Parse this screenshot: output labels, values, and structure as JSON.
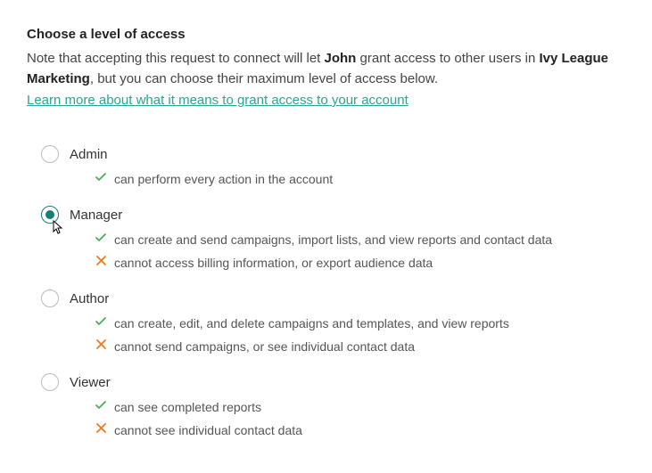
{
  "heading": "Choose a level of access",
  "note": {
    "prefix": "Note that accepting this request to connect will let ",
    "user": "John",
    "middle": " grant access to other users in ",
    "company": "Ivy League Marketing",
    "suffix": ", but you can choose their maximum level of access below."
  },
  "link_text": "Learn more about what it means to grant access to your account",
  "options": {
    "admin": {
      "label": "Admin",
      "can1": "can perform every action in the account"
    },
    "manager": {
      "label": "Manager",
      "can1": "can create and send campaigns, import lists, and view reports and contact data",
      "cannot1": "cannot access billing information, or export audience data"
    },
    "author": {
      "label": "Author",
      "can1": "can create, edit, and delete campaigns and templates, and view reports",
      "cannot1": "cannot send campaigns, or see individual contact data"
    },
    "viewer": {
      "label": "Viewer",
      "can1": "can see completed reports",
      "cannot1": "cannot see individual contact data"
    }
  }
}
